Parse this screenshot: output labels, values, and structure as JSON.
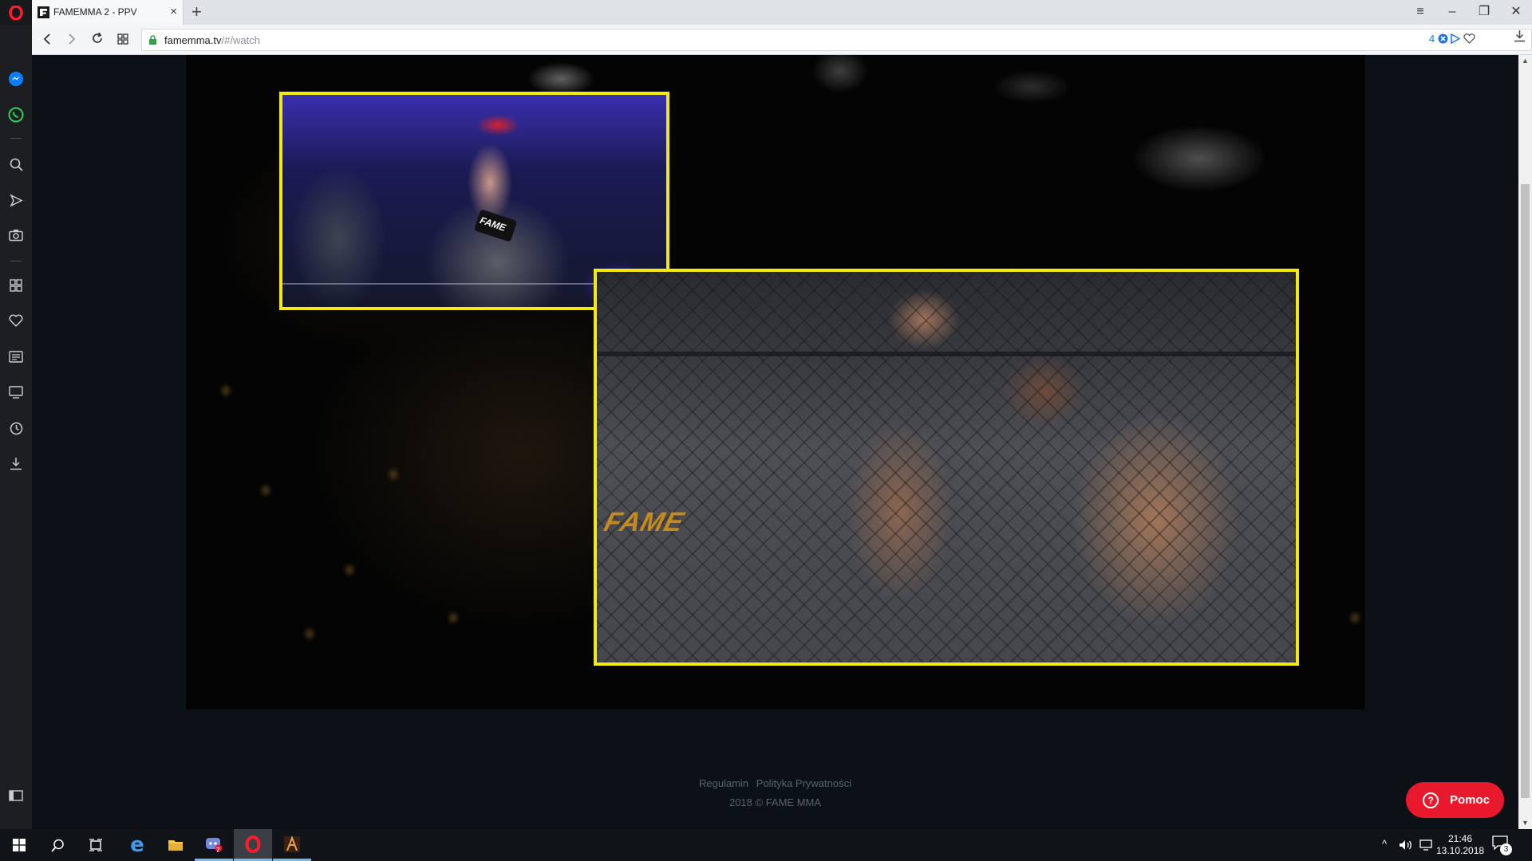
{
  "browser": {
    "tab_title": "FAMEMMA 2 - PPV",
    "new_tab": "+",
    "tab_close": "×",
    "window_controls": {
      "minimize": "–",
      "restore": "❐",
      "close": "✕",
      "menu": "≡"
    },
    "url_host": "famemma.tv",
    "url_path": "/#/watch",
    "adblock_count": "4"
  },
  "sidebar": {
    "items": [
      "messenger-icon",
      "whatsapp-icon",
      "search-icon",
      "flow-icon",
      "snapshot-icon",
      "speed-dial-icon",
      "bookmarks-heart-icon",
      "news-icon",
      "tabs-icon",
      "history-icon",
      "downloads-icon",
      "sidebar-toggle-icon"
    ]
  },
  "video": {
    "inset_mic_text": "FAME",
    "ring_logo_text": "FAME"
  },
  "footer": {
    "link_terms": "Regulamin",
    "link_privacy": "Polityka Prywatności",
    "copyright": "2018 © FAME MMA"
  },
  "help_button": {
    "label": "Pomoc",
    "icon": "?"
  },
  "taskbar": {
    "time": "21:46",
    "date": "13.10.2018",
    "notification_count": "3",
    "app_badge": "7"
  },
  "colors": {
    "inset_border": "#f3ea10",
    "help_button": "#e8192c",
    "opera_red": "#ff1b2d"
  }
}
